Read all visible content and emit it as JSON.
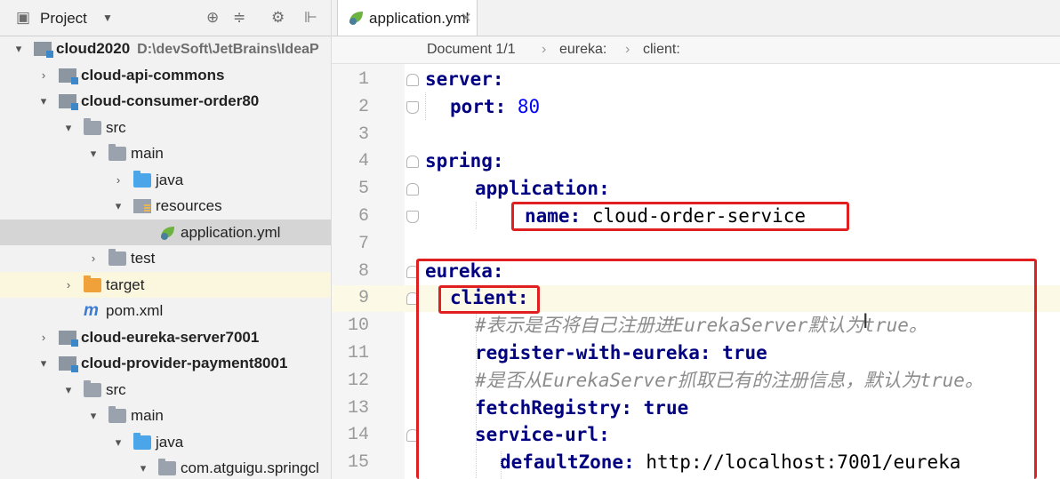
{
  "panel": {
    "title": "Project",
    "dropdown": "▼",
    "tools": [
      "⊕",
      "≑",
      "⚙",
      "⊩"
    ]
  },
  "tree": [
    {
      "label": "cloud2020",
      "path": "D:\\devSoft\\JetBrains\\IdeaP",
      "arrow": "▾",
      "icon": "module",
      "bold": true
    },
    {
      "label": "cloud-api-commons",
      "arrow": "›",
      "icon": "module",
      "bold": true
    },
    {
      "label": "cloud-consumer-order80",
      "arrow": "▾",
      "icon": "module",
      "bold": true
    },
    {
      "label": "src",
      "arrow": "▾",
      "icon": "folder"
    },
    {
      "label": "main",
      "arrow": "▾",
      "icon": "folder"
    },
    {
      "label": "java",
      "arrow": "›",
      "icon": "folder-blue"
    },
    {
      "label": "resources",
      "arrow": "▾",
      "icon": "resources"
    },
    {
      "label": "application.yml",
      "arrow": "",
      "icon": "spring-leaf",
      "selected": true
    },
    {
      "label": "test",
      "arrow": "›",
      "icon": "folder"
    },
    {
      "label": "target",
      "arrow": "›",
      "icon": "folder-orange",
      "excluded": true
    },
    {
      "label": "pom.xml",
      "arrow": "",
      "icon": "maven"
    },
    {
      "label": "cloud-eureka-server7001",
      "arrow": "›",
      "icon": "module",
      "bold": true
    },
    {
      "label": "cloud-provider-payment8001",
      "arrow": "▾",
      "icon": "module",
      "bold": true
    },
    {
      "label": "src",
      "arrow": "▾",
      "icon": "folder"
    },
    {
      "label": "main",
      "arrow": "▾",
      "icon": "folder"
    },
    {
      "label": "java",
      "arrow": "▾",
      "icon": "folder-blue"
    },
    {
      "label": "com.atguigu.springcl",
      "arrow": "▾",
      "icon": "package"
    }
  ],
  "editor": {
    "tab": {
      "label": "application.yml",
      "close": "✕"
    },
    "breadcrumb": [
      "Document 1/1",
      "eureka:",
      "client:"
    ],
    "breadcrumb_sep": "›",
    "cursor_glyph": "I",
    "lines": [
      {
        "num": "1",
        "tokens": [
          {
            "t": "server:",
            "c": "key"
          }
        ]
      },
      {
        "num": "2",
        "tokens": [
          {
            "t": "port: ",
            "c": "key"
          },
          {
            "t": "80",
            "c": "val"
          }
        ]
      },
      {
        "num": "3",
        "tokens": []
      },
      {
        "num": "4",
        "tokens": [
          {
            "t": "spring:",
            "c": "key"
          }
        ]
      },
      {
        "num": "5",
        "tokens": [
          {
            "t": "application:",
            "c": "key"
          }
        ]
      },
      {
        "num": "6",
        "tokens": [
          {
            "t": "name: ",
            "c": "key"
          },
          {
            "t": "cloud-order-service",
            "c": "plain"
          }
        ]
      },
      {
        "num": "7",
        "tokens": []
      },
      {
        "num": "8",
        "tokens": [
          {
            "t": "eureka:",
            "c": "key"
          }
        ]
      },
      {
        "num": "9",
        "tokens": [
          {
            "t": "client:",
            "c": "key"
          }
        ]
      },
      {
        "num": "10",
        "tokens": [
          {
            "t": "#表示是否将自己注册进EurekaServer默认为true。",
            "c": "comment"
          }
        ]
      },
      {
        "num": "11",
        "tokens": [
          {
            "t": "register-with-eureka: ",
            "c": "key"
          },
          {
            "t": "true",
            "c": "key"
          }
        ]
      },
      {
        "num": "12",
        "tokens": [
          {
            "t": "#是否从EurekaServer抓取已有的注册信息，默认为true。",
            "c": "comment"
          }
        ]
      },
      {
        "num": "13",
        "tokens": [
          {
            "t": "fetchRegistry: ",
            "c": "key"
          },
          {
            "t": "true",
            "c": "key"
          }
        ]
      },
      {
        "num": "14",
        "tokens": [
          {
            "t": "service-url:",
            "c": "key"
          }
        ]
      },
      {
        "num": "15",
        "tokens": [
          {
            "t": "defaultZone: ",
            "c": "key"
          },
          {
            "t": "http://localhost:7001/eureka",
            "c": "plain"
          }
        ]
      }
    ]
  },
  "colors": {
    "highlight": "#e02020",
    "key": "#000080",
    "number": "#0000ff",
    "comment": "#8c8c8c"
  }
}
